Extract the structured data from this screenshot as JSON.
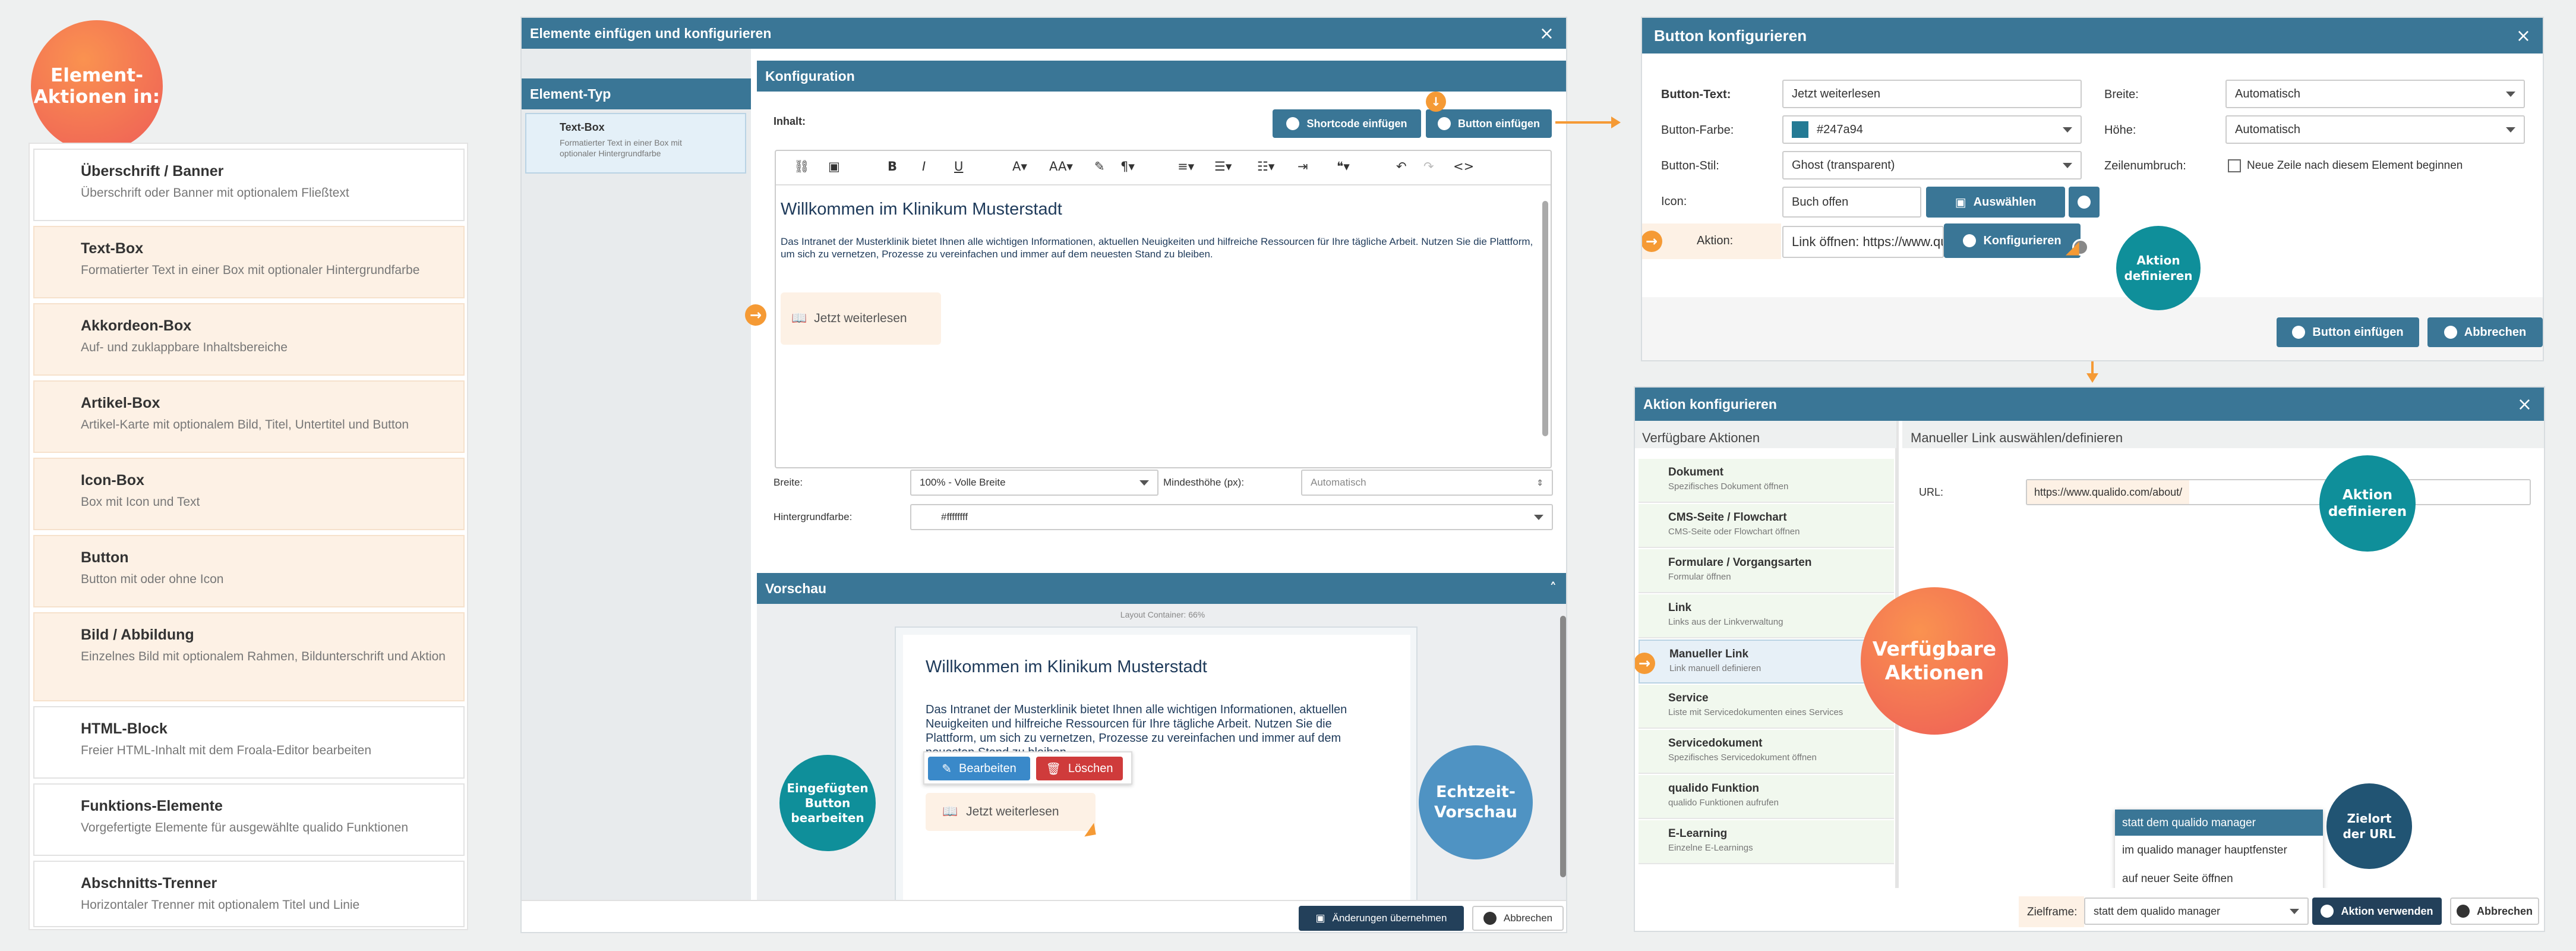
{
  "badges": {
    "element_actions": "Element-\nAktionen in:",
    "aktion_definieren_1": "Aktion\ndefinieren",
    "aktion_definieren_2": "Aktion\ndefinieren",
    "verfuegbare_aktionen": "Verfügbare\nAktionen",
    "eingefuegten_button": "Eingefügten\nButton\nbearbeiten",
    "echtzeit_vorschau": "Echtzeit-\nVorschau",
    "zielort": "Zielort\nder URL"
  },
  "element_list": [
    {
      "title": "Überschrift / Banner",
      "desc": "Überschrift oder Banner mit optionalem Fließtext"
    },
    {
      "title": "Text-Box",
      "desc": "Formatierter Text in einer Box mit optionaler Hintergrundfarbe"
    },
    {
      "title": "Akkordeon-Box",
      "desc": "Auf- und zuklappbare Inhaltsbereiche"
    },
    {
      "title": "Artikel-Box",
      "desc": "Artikel-Karte mit optionalem Bild, Titel, Untertitel und Button"
    },
    {
      "title": "Icon-Box",
      "desc": "Box mit Icon und Text"
    },
    {
      "title": "Button",
      "desc": "Button mit oder ohne Icon"
    },
    {
      "title": "Bild / Abbildung",
      "desc": "Einzelnes Bild mit optionalem Rahmen, Bildunterschrift und Aktion"
    },
    {
      "title": "HTML-Block",
      "desc": "Freier HTML-Inhalt mit dem Froala-Editor bearbeiten"
    },
    {
      "title": "Funktions-Elemente",
      "desc": "Vorgefertigte Elemente für ausgewählte qualido Funktionen"
    },
    {
      "title": "Abschnitts-Trenner",
      "desc": "Horizontaler Trenner mit optionalem Titel und Linie"
    }
  ],
  "main_window": {
    "title": "Elemente einfügen und konfigurieren",
    "element_typ_header": "Element-Typ",
    "selected_type": {
      "title": "Text-Box",
      "desc": "Formatierter Text in einer Box mit optionaler Hintergrundfarbe"
    },
    "konfiguration_header": "Konfiguration",
    "inhalt_label": "Inhalt:",
    "shortcode_button": "Shortcode einfügen",
    "button_einfuegen": "Button einfügen",
    "editor_heading": "Willkommen im Klinikum Musterstadt",
    "editor_text": "Das Intranet der Musterklinik bietet Ihnen alle wichtigen Informationen, aktuellen Neuigkeiten und hilfreiche Ressourcen für Ihre tägliche Arbeit. Nutzen Sie die Plattform, um sich zu vernetzen, Prozesse zu vereinfachen und immer auf dem neuesten Stand zu bleiben.",
    "editor_button": "Jetzt weiterlesen",
    "breite_label": "Breite:",
    "breite_value": "100% - Volle Breite",
    "mindesthoehe_label": "Mindesthöhe (px):",
    "mindesthoehe_placeholder": "Automatisch",
    "hintergrund_label": "Hintergrundfarbe:",
    "hintergrund_value": "#ffffffff",
    "vorschau_header": "Vorschau",
    "layout_container": "Layout Container: 66%",
    "preview_heading": "Willkommen im Klinikum Musterstadt",
    "preview_text": "Das Intranet der Musterklinik bietet Ihnen alle wichtigen Informationen, aktuellen Neuigkeiten und hilfreiche Ressourcen für Ihre tägliche Arbeit. Nutzen Sie die Plattform, um sich zu vernetzen, Prozesse zu vereinfachen und immer auf dem neuesten Stand zu bleiben.",
    "bearbeiten": "Bearbeiten",
    "loeschen": "Löschen",
    "preview_button": "Jetzt weiterlesen",
    "uebernehmen": "Änderungen übernehmen",
    "abbrechen": "Abbrechen"
  },
  "button_window": {
    "title": "Button konfigurieren",
    "text_label": "Button-Text:",
    "text_value": "Jetzt weiterlesen",
    "farbe_label": "Button-Farbe:",
    "farbe_value": "#247a94",
    "farbe_hex": "#247a94",
    "stil_label": "Button-Stil:",
    "stil_value": "Ghost (transparent)",
    "icon_label": "Icon:",
    "icon_value": "Buch offen",
    "auswaehlen": "Auswählen",
    "aktion_label": "Aktion:",
    "aktion_value": "Link öffnen: https://www.qualido.com/about/",
    "konfigurieren": "Konfigurieren",
    "breite_label": "Breite:",
    "breite_value": "Automatisch",
    "hoehe_label": "Höhe:",
    "hoehe_value": "Automatisch",
    "zeilenumbruch_label": "Zeilenumbruch:",
    "zeilenumbruch_text": "Neue Zeile nach diesem Element beginnen",
    "button_einfuegen": "Button einfügen",
    "abbrechen": "Abbrechen"
  },
  "aktion_window": {
    "title": "Aktion konfigurieren",
    "left_header": "Verfügbare Aktionen",
    "right_header": "Manueller Link auswählen/definieren",
    "actions": [
      {
        "title": "Dokument",
        "desc": "Spezifisches Dokument öffnen"
      },
      {
        "title": "CMS-Seite / Flowchart",
        "desc": "CMS-Seite oder Flowchart öffnen"
      },
      {
        "title": "Formulare / Vorgangsarten",
        "desc": "Formular öffnen"
      },
      {
        "title": "Link",
        "desc": "Links aus der Linkverwaltung"
      },
      {
        "title": "Manueller Link",
        "desc": "Link manuell definieren"
      },
      {
        "title": "Service",
        "desc": "Liste mit Servicedokumenten eines Services"
      },
      {
        "title": "Servicedokument",
        "desc": "Spezifisches Servicedokument öffnen"
      },
      {
        "title": "qualido Funktion",
        "desc": "qualido Funktionen aufrufen"
      },
      {
        "title": "E-Learning",
        "desc": "Einzelne E-Learnings"
      }
    ],
    "url_label": "URL:",
    "url_value": "https://www.qualido.com/about/",
    "dropdown_options": [
      "statt dem qualido manager",
      "im qualido manager hauptfenster",
      "auf neuer Seite öffnen"
    ],
    "zielframe_label": "Zielframe:",
    "zielframe_value": "statt dem qualido manager",
    "verwenden": "Aktion verwenden",
    "abbrechen": "Abbrechen"
  },
  "colors": {
    "accent": "#3a7696",
    "orange": "#f59a35",
    "teal": "#0f8f9a",
    "dark": "#23405a"
  }
}
